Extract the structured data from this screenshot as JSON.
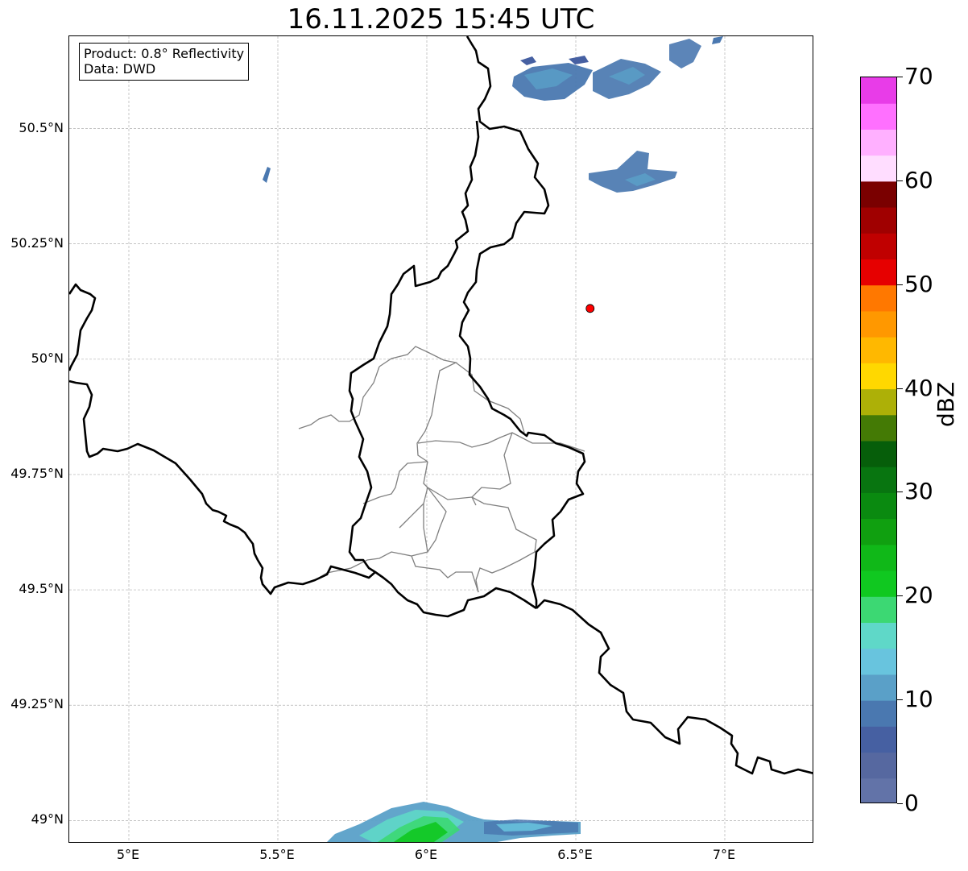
{
  "title": "16.11.2025 15:45 UTC",
  "info_box": {
    "product": "Product: 0.8° Reflectivity",
    "data_source": "Data: DWD"
  },
  "lat_ticks": [
    "50.5°N",
    "50.25°N",
    "50°N",
    "49.75°N",
    "49.5°N",
    "49.25°N",
    "49°N"
  ],
  "lon_ticks": [
    "5°E",
    "5.5°E",
    "6°E",
    "6.5°E",
    "7°E"
  ],
  "colorbar": {
    "label": "dBZ",
    "ticks": [
      "0",
      "10",
      "20",
      "30",
      "40",
      "50",
      "60",
      "70"
    ],
    "min": 0,
    "max": 70,
    "colors": [
      "#6273a8",
      "#5668a0",
      "#4660a2",
      "#4a78b0",
      "#5aa0c8",
      "#68c4de",
      "#5fd8c8",
      "#3cd873",
      "#10c820",
      "#10b818",
      "#10a010",
      "#0a8a10",
      "#087510",
      "#065e0a",
      "#447a05",
      "#adb007",
      "#ffd800",
      "#ffb800",
      "#ff9800",
      "#ff7800",
      "#e60000",
      "#c00000",
      "#a00000",
      "#7a0000",
      "#ffddff",
      "#ffb0ff",
      "#ff70ff",
      "#e83ce8"
    ]
  },
  "map": {
    "extent": {
      "lon_min": 4.8,
      "lon_max": 7.3,
      "lat_min": 48.95,
      "lat_max": 50.7
    },
    "radar_site": {
      "lon": 6.548,
      "lat": 50.11,
      "color": "#ff0000"
    },
    "gridline_color": "#b0b0b0",
    "country_border_color": "#000000",
    "canton_border_color": "#808080"
  }
}
